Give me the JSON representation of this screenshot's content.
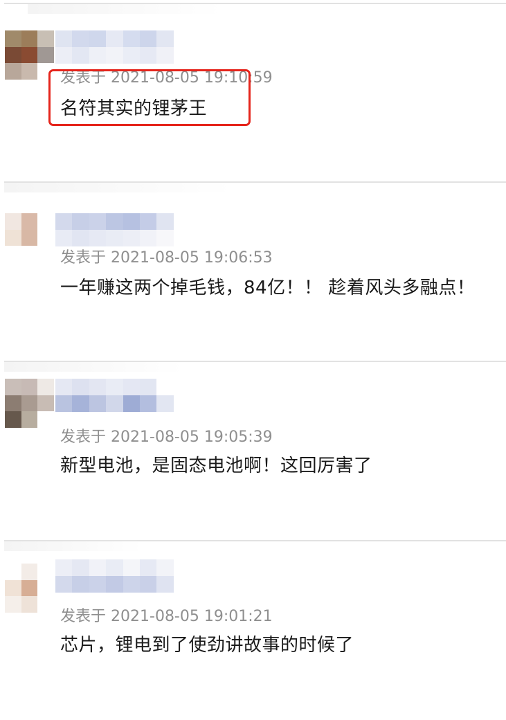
{
  "comments": [
    {
      "meta_prefix": "发表于",
      "timestamp": "2021-08-05 19:10:59",
      "text": "名符其实的锂茅王"
    },
    {
      "meta_prefix": "发表于",
      "timestamp": "2021-08-05 19:06:53",
      "text": "一年赚这两个掉毛钱，84亿！！ 趁着风头多融点！"
    },
    {
      "meta_prefix": "发表于",
      "timestamp": "2021-08-05 19:05:39",
      "text": "新型电池，是固态电池啊！这回厉害了"
    },
    {
      "meta_prefix": "发表于",
      "timestamp": "2021-08-05 19:01:21",
      "text": "芯片，锂电到了使劲讲故事的时候了"
    }
  ],
  "colors": {
    "highlight_border": "#e5241b",
    "separator": "#e2e2e2",
    "meta_text": "#8f8f8f",
    "body_text": "#1a1a1a"
  }
}
